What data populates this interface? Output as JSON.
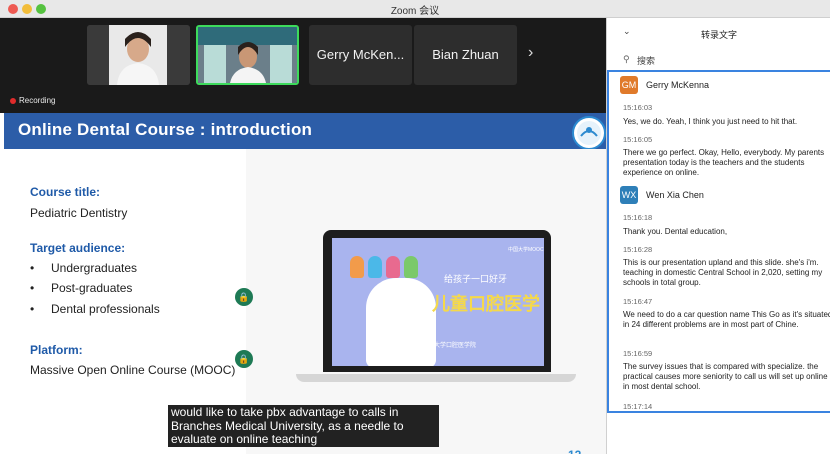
{
  "window": {
    "title": "Zoom 会议"
  },
  "gallery": {
    "participants": [
      {
        "name": ""
      },
      {
        "name": ""
      },
      {
        "name": "Gerry McKen..."
      },
      {
        "name": "Bian Zhuan"
      }
    ],
    "next_label": "›"
  },
  "recording": {
    "label": "Recording"
  },
  "slide": {
    "title": "Online Dental Course : introduction",
    "course_title_heading": "Course title:",
    "course_title_value": "Pediatric Dentistry",
    "audience_heading": "Target audience:",
    "audience_items": [
      "Undergraduates",
      "Post-graduates",
      "Dental professionals"
    ],
    "platform_heading": "Platform:",
    "platform_value": "Massive Open Online Course (MOOC)",
    "page_number": "12",
    "laptop": {
      "brand": "中国大学MOOC",
      "subtitle": "给孩子一口好牙",
      "headline": "儿童口腔医学",
      "footer": "广西医科大学口腔医学院"
    }
  },
  "caption": {
    "text": "would like to take pbx advantage to calls in Branches Medical University, as a needle to evaluate on online teaching"
  },
  "transcript": {
    "title": "转录文字",
    "search_placeholder": "搜索",
    "entries": [
      {
        "speaker": "Gerry McKenna",
        "initials": "GM",
        "color": "#e07a2a"
      },
      {
        "speaker": "Wen Xia Chen",
        "initials": "WX",
        "color": "#2e7fb8"
      }
    ],
    "messages": [
      {
        "time": "15:16:03",
        "text": "Yes, we do. Yeah, I think you just need to hit that."
      },
      {
        "time": "15:16:05",
        "text": "There we go perfect. Okay, Hello, everybody. My parents presentation today is the teachers and the students experience on online."
      },
      {
        "time": "15:16:18",
        "text": "Thank you. Dental education,"
      },
      {
        "time": "15:16:28",
        "text": "This is our presentation upland and this slide. she's i'm. teaching in domestic Central School in 2,020, setting my schools in total group."
      },
      {
        "time": "15:16:47",
        "text": "We need to do a car question name This Go as it's situated in 24 different problems are in most part of Chine."
      },
      {
        "time": "15:16:59",
        "text": "The survey issues that is compared with specialize. the practical causes more seniority to call us will set up online in most dental school."
      },
      {
        "time": "15:17:14",
        "text": ""
      }
    ]
  },
  "colors": {
    "slide_header": "#2c5da8",
    "section_heading": "#1f5aa8",
    "active_speaker": "#3ddb5c",
    "transcript_border": "#3a83e0"
  }
}
